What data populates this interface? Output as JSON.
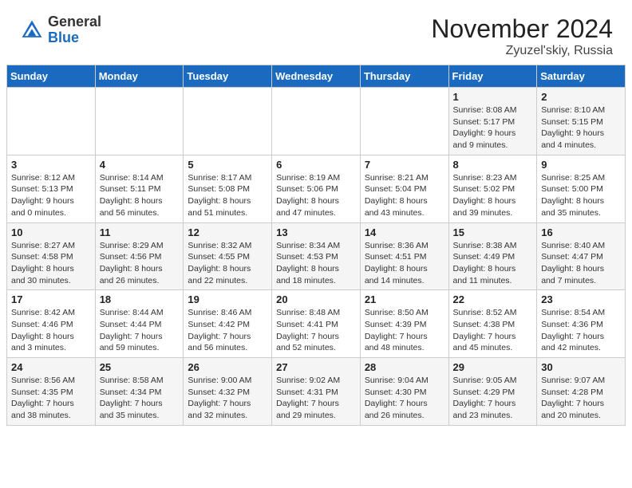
{
  "logo": {
    "general": "General",
    "blue": "Blue"
  },
  "title": "November 2024",
  "location": "Zyuzel'skiy, Russia",
  "days_of_week": [
    "Sunday",
    "Monday",
    "Tuesday",
    "Wednesday",
    "Thursday",
    "Friday",
    "Saturday"
  ],
  "weeks": [
    [
      {
        "day": "",
        "info": ""
      },
      {
        "day": "",
        "info": ""
      },
      {
        "day": "",
        "info": ""
      },
      {
        "day": "",
        "info": ""
      },
      {
        "day": "",
        "info": ""
      },
      {
        "day": "1",
        "info": "Sunrise: 8:08 AM\nSunset: 5:17 PM\nDaylight: 9 hours\nand 9 minutes."
      },
      {
        "day": "2",
        "info": "Sunrise: 8:10 AM\nSunset: 5:15 PM\nDaylight: 9 hours\nand 4 minutes."
      }
    ],
    [
      {
        "day": "3",
        "info": "Sunrise: 8:12 AM\nSunset: 5:13 PM\nDaylight: 9 hours\nand 0 minutes."
      },
      {
        "day": "4",
        "info": "Sunrise: 8:14 AM\nSunset: 5:11 PM\nDaylight: 8 hours\nand 56 minutes."
      },
      {
        "day": "5",
        "info": "Sunrise: 8:17 AM\nSunset: 5:08 PM\nDaylight: 8 hours\nand 51 minutes."
      },
      {
        "day": "6",
        "info": "Sunrise: 8:19 AM\nSunset: 5:06 PM\nDaylight: 8 hours\nand 47 minutes."
      },
      {
        "day": "7",
        "info": "Sunrise: 8:21 AM\nSunset: 5:04 PM\nDaylight: 8 hours\nand 43 minutes."
      },
      {
        "day": "8",
        "info": "Sunrise: 8:23 AM\nSunset: 5:02 PM\nDaylight: 8 hours\nand 39 minutes."
      },
      {
        "day": "9",
        "info": "Sunrise: 8:25 AM\nSunset: 5:00 PM\nDaylight: 8 hours\nand 35 minutes."
      }
    ],
    [
      {
        "day": "10",
        "info": "Sunrise: 8:27 AM\nSunset: 4:58 PM\nDaylight: 8 hours\nand 30 minutes."
      },
      {
        "day": "11",
        "info": "Sunrise: 8:29 AM\nSunset: 4:56 PM\nDaylight: 8 hours\nand 26 minutes."
      },
      {
        "day": "12",
        "info": "Sunrise: 8:32 AM\nSunset: 4:55 PM\nDaylight: 8 hours\nand 22 minutes."
      },
      {
        "day": "13",
        "info": "Sunrise: 8:34 AM\nSunset: 4:53 PM\nDaylight: 8 hours\nand 18 minutes."
      },
      {
        "day": "14",
        "info": "Sunrise: 8:36 AM\nSunset: 4:51 PM\nDaylight: 8 hours\nand 14 minutes."
      },
      {
        "day": "15",
        "info": "Sunrise: 8:38 AM\nSunset: 4:49 PM\nDaylight: 8 hours\nand 11 minutes."
      },
      {
        "day": "16",
        "info": "Sunrise: 8:40 AM\nSunset: 4:47 PM\nDaylight: 8 hours\nand 7 minutes."
      }
    ],
    [
      {
        "day": "17",
        "info": "Sunrise: 8:42 AM\nSunset: 4:46 PM\nDaylight: 8 hours\nand 3 minutes."
      },
      {
        "day": "18",
        "info": "Sunrise: 8:44 AM\nSunset: 4:44 PM\nDaylight: 7 hours\nand 59 minutes."
      },
      {
        "day": "19",
        "info": "Sunrise: 8:46 AM\nSunset: 4:42 PM\nDaylight: 7 hours\nand 56 minutes."
      },
      {
        "day": "20",
        "info": "Sunrise: 8:48 AM\nSunset: 4:41 PM\nDaylight: 7 hours\nand 52 minutes."
      },
      {
        "day": "21",
        "info": "Sunrise: 8:50 AM\nSunset: 4:39 PM\nDaylight: 7 hours\nand 48 minutes."
      },
      {
        "day": "22",
        "info": "Sunrise: 8:52 AM\nSunset: 4:38 PM\nDaylight: 7 hours\nand 45 minutes."
      },
      {
        "day": "23",
        "info": "Sunrise: 8:54 AM\nSunset: 4:36 PM\nDaylight: 7 hours\nand 42 minutes."
      }
    ],
    [
      {
        "day": "24",
        "info": "Sunrise: 8:56 AM\nSunset: 4:35 PM\nDaylight: 7 hours\nand 38 minutes."
      },
      {
        "day": "25",
        "info": "Sunrise: 8:58 AM\nSunset: 4:34 PM\nDaylight: 7 hours\nand 35 minutes."
      },
      {
        "day": "26",
        "info": "Sunrise: 9:00 AM\nSunset: 4:32 PM\nDaylight: 7 hours\nand 32 minutes."
      },
      {
        "day": "27",
        "info": "Sunrise: 9:02 AM\nSunset: 4:31 PM\nDaylight: 7 hours\nand 29 minutes."
      },
      {
        "day": "28",
        "info": "Sunrise: 9:04 AM\nSunset: 4:30 PM\nDaylight: 7 hours\nand 26 minutes."
      },
      {
        "day": "29",
        "info": "Sunrise: 9:05 AM\nSunset: 4:29 PM\nDaylight: 7 hours\nand 23 minutes."
      },
      {
        "day": "30",
        "info": "Sunrise: 9:07 AM\nSunset: 4:28 PM\nDaylight: 7 hours\nand 20 minutes."
      }
    ]
  ]
}
